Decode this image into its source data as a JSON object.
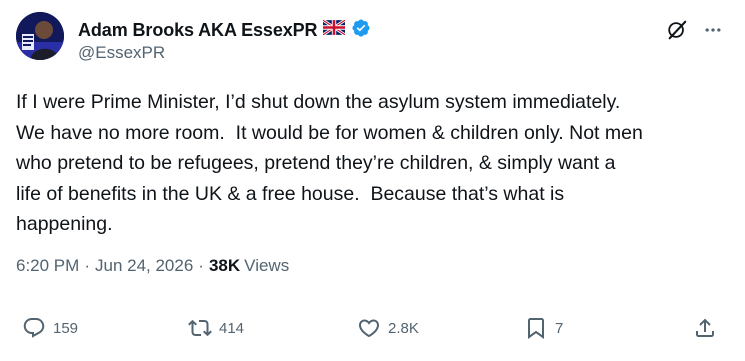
{
  "author": {
    "display_name": "Adam Brooks AKA EssexPR",
    "flag_icon": "uk-flag-icon",
    "verified_icon": "verified-badge-icon",
    "handle": "@EssexPR"
  },
  "tweet": {
    "text": "If I were Prime Minister, I’d shut down the asylum system immediately.\nWe have no more room.  It would be for women & children only. Not men\nwho pretend to be refugees, pretend they’re children, & simply want a\nlife of benefits in the UK & a free house.  Because that’s what is\nhappening."
  },
  "meta": {
    "time": "6:20 PM",
    "separator": "·",
    "date": "Jun 24, 2026",
    "views_count": "38K",
    "views_label": "Views"
  },
  "actions": {
    "replies": "159",
    "reposts": "414",
    "likes": "2.8K",
    "bookmarks": "7"
  },
  "colors": {
    "text": "#0f1419",
    "secondary": "#536471",
    "verified": "#1d9bf0"
  }
}
